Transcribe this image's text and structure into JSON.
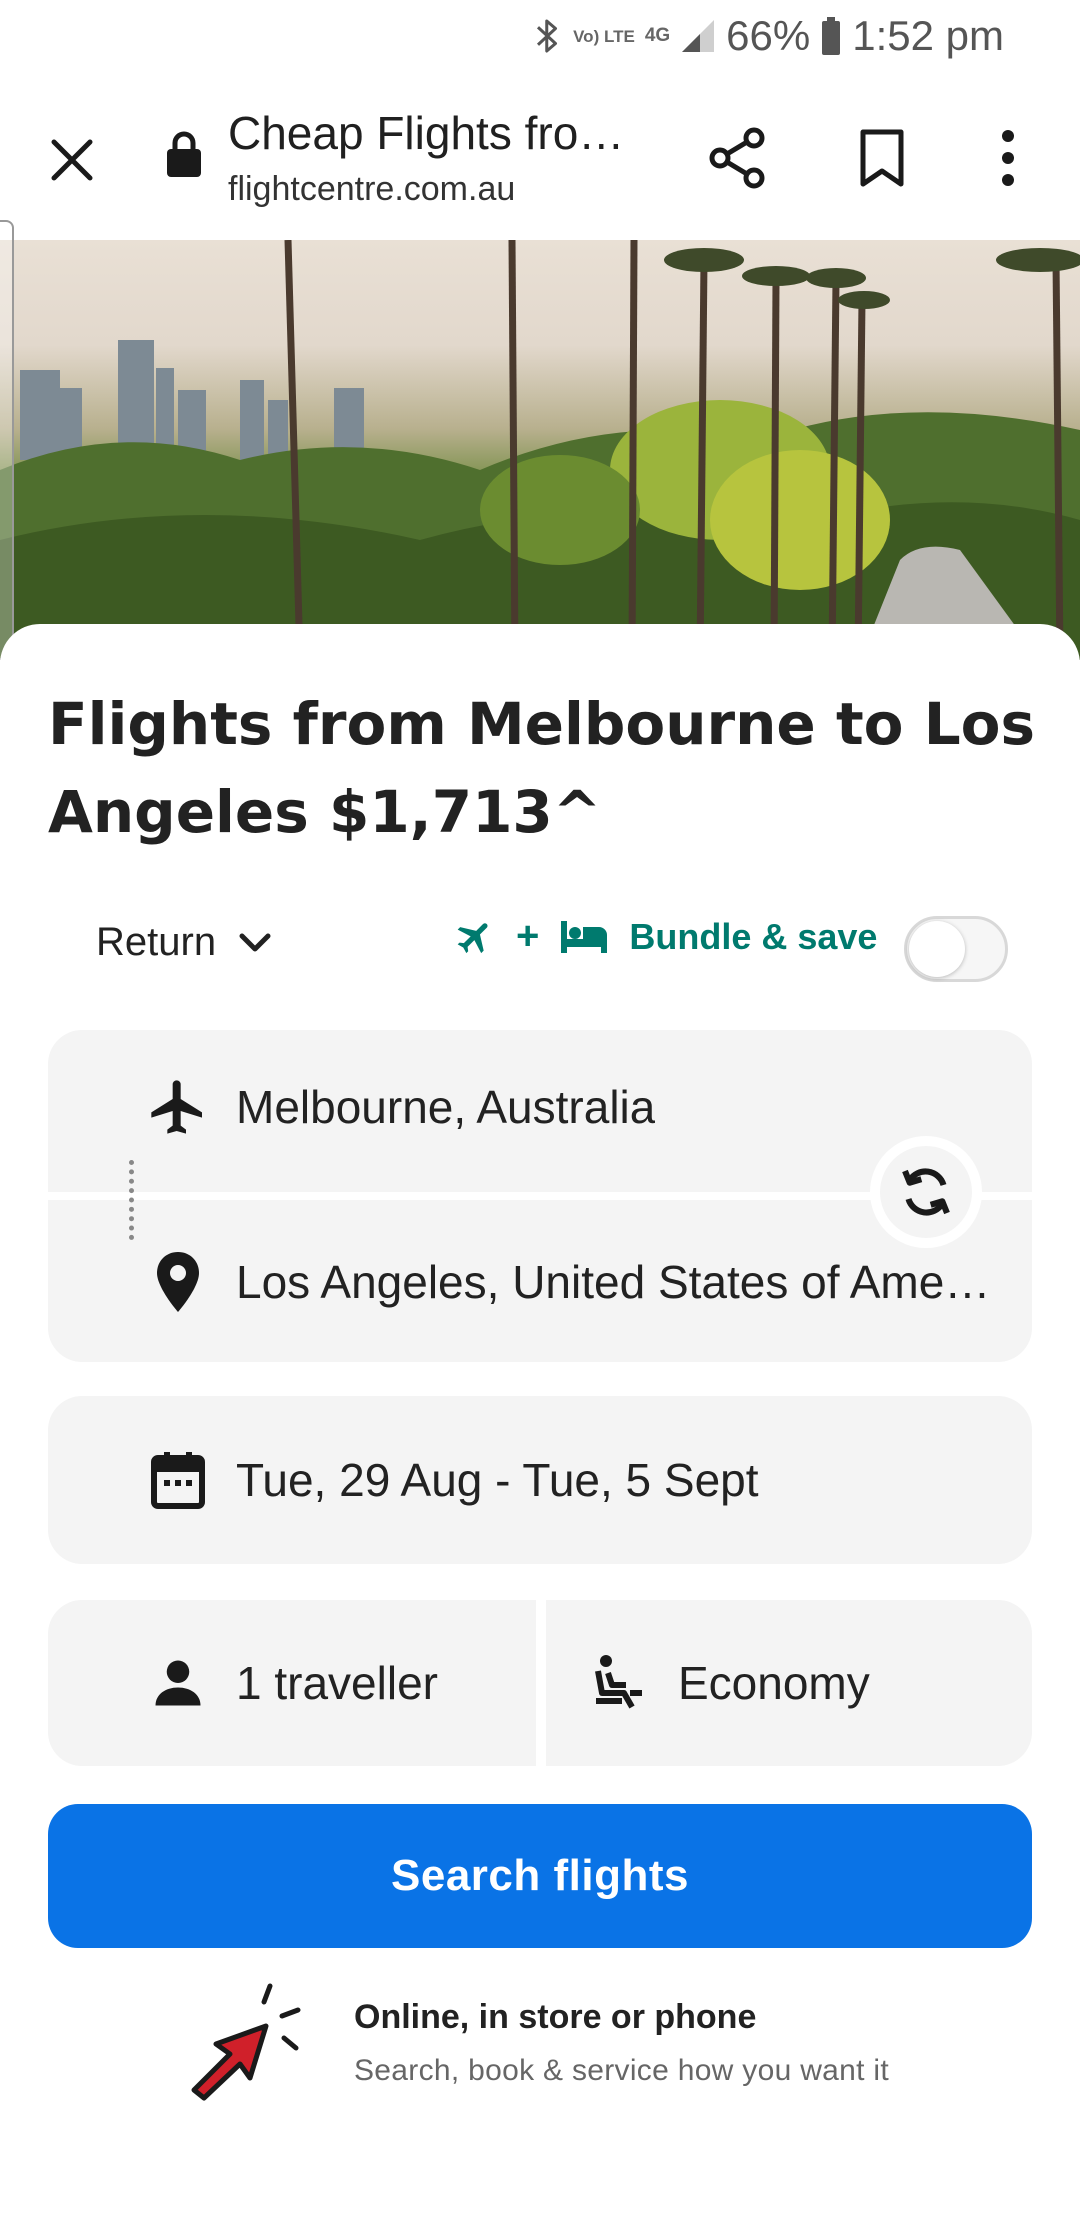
{
  "status_bar": {
    "battery": "66%",
    "time": "1:52 pm",
    "lte_label": "Vo) LTE",
    "network_label": "4G"
  },
  "browser": {
    "title": "Cheap Flights fro…",
    "url": "flightcentre.com.au"
  },
  "page": {
    "heading": "Flights from Melbourne to Los Angeles $1,713^"
  },
  "search": {
    "trip_type": "Return",
    "bundle_label": "Bundle & save",
    "bundle_plus": "+",
    "bundle_enabled": false,
    "origin": "Melbourne, Australia",
    "destination": "Los Angeles, United States of Ame…",
    "dates": "Tue, 29 Aug - Tue, 5 Sept",
    "travellers": "1 traveller",
    "cabin": "Economy",
    "submit_label": "Search flights"
  },
  "promo": {
    "title": "Online, in store or phone",
    "subtitle": "Search, book & service how you want it"
  },
  "colors": {
    "accent_blue": "#0a73e6",
    "bundle_teal": "#007a6e",
    "field_bg": "#f4f4f4"
  },
  "icons": [
    "bluetooth-icon",
    "signal-icon",
    "battery-icon",
    "close-icon",
    "lock-icon",
    "share-icon",
    "bookmark-icon",
    "more-vert-icon",
    "chevron-down-icon",
    "plane-icon",
    "bed-icon",
    "departure-plane-icon",
    "location-pin-icon",
    "swap-icon",
    "calendar-icon",
    "person-icon",
    "seat-icon",
    "click-cursor-icon"
  ]
}
